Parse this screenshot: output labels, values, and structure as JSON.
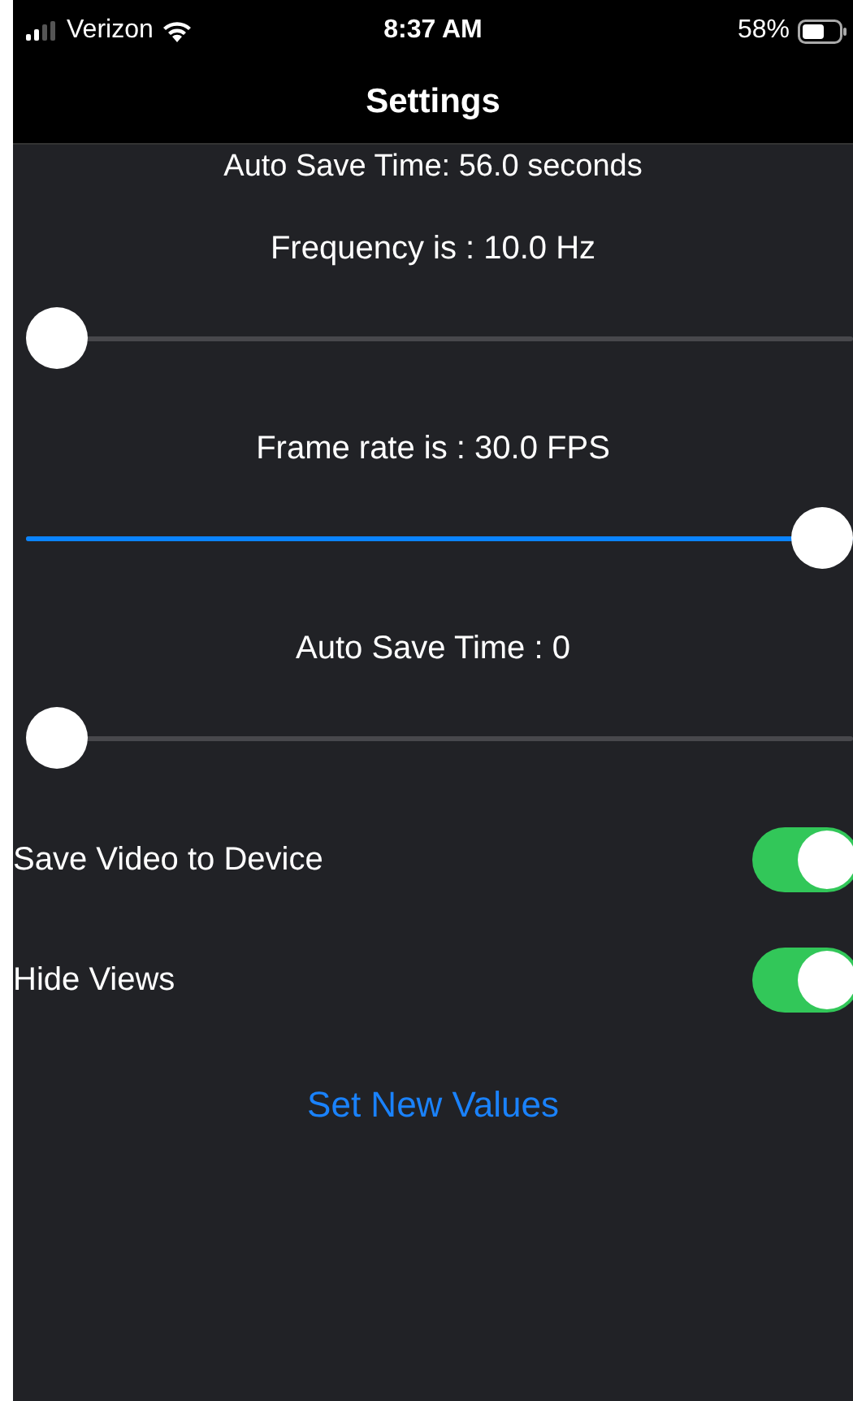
{
  "status_bar": {
    "carrier": "Verizon",
    "time": "8:37 AM",
    "battery": "58%"
  },
  "nav": {
    "title": "Settings"
  },
  "cut_label": "Auto Save Time: 56.0 seconds",
  "sliders": [
    {
      "label": "Frequency is : 10.0 Hz",
      "level": 0
    },
    {
      "label": "Frame rate is : 30.0 FPS",
      "level": 1
    },
    {
      "label": "Auto Save Time : 0",
      "level": 0
    }
  ],
  "switches": [
    {
      "label": "Save Video to Device",
      "on": true
    },
    {
      "label": "Hide Views",
      "on": true
    }
  ],
  "button": "Set New Values"
}
